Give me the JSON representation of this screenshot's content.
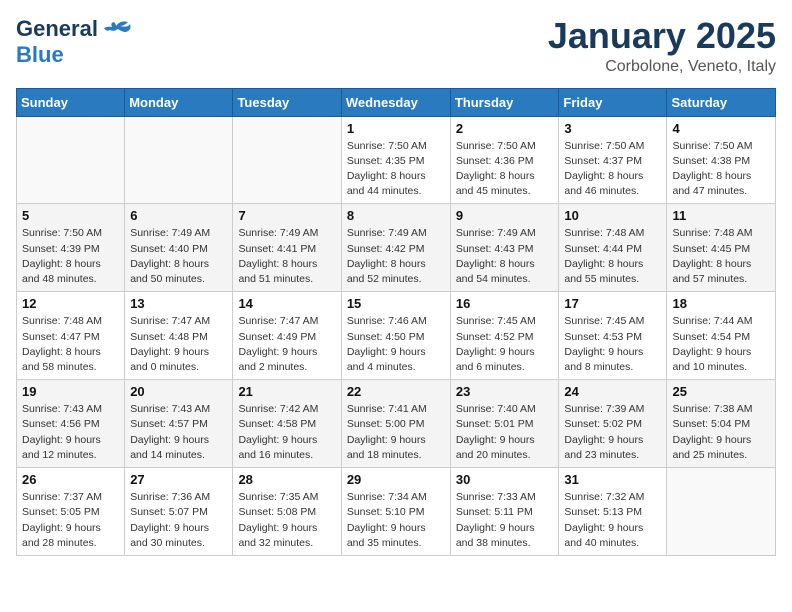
{
  "header": {
    "logo_line1": "General",
    "logo_line2": "Blue",
    "month": "January 2025",
    "location": "Corbolone, Veneto, Italy"
  },
  "days_of_week": [
    "Sunday",
    "Monday",
    "Tuesday",
    "Wednesday",
    "Thursday",
    "Friday",
    "Saturday"
  ],
  "weeks": [
    [
      {
        "day": "",
        "info": ""
      },
      {
        "day": "",
        "info": ""
      },
      {
        "day": "",
        "info": ""
      },
      {
        "day": "1",
        "info": "Sunrise: 7:50 AM\nSunset: 4:35 PM\nDaylight: 8 hours\nand 44 minutes."
      },
      {
        "day": "2",
        "info": "Sunrise: 7:50 AM\nSunset: 4:36 PM\nDaylight: 8 hours\nand 45 minutes."
      },
      {
        "day": "3",
        "info": "Sunrise: 7:50 AM\nSunset: 4:37 PM\nDaylight: 8 hours\nand 46 minutes."
      },
      {
        "day": "4",
        "info": "Sunrise: 7:50 AM\nSunset: 4:38 PM\nDaylight: 8 hours\nand 47 minutes."
      }
    ],
    [
      {
        "day": "5",
        "info": "Sunrise: 7:50 AM\nSunset: 4:39 PM\nDaylight: 8 hours\nand 48 minutes."
      },
      {
        "day": "6",
        "info": "Sunrise: 7:49 AM\nSunset: 4:40 PM\nDaylight: 8 hours\nand 50 minutes."
      },
      {
        "day": "7",
        "info": "Sunrise: 7:49 AM\nSunset: 4:41 PM\nDaylight: 8 hours\nand 51 minutes."
      },
      {
        "day": "8",
        "info": "Sunrise: 7:49 AM\nSunset: 4:42 PM\nDaylight: 8 hours\nand 52 minutes."
      },
      {
        "day": "9",
        "info": "Sunrise: 7:49 AM\nSunset: 4:43 PM\nDaylight: 8 hours\nand 54 minutes."
      },
      {
        "day": "10",
        "info": "Sunrise: 7:48 AM\nSunset: 4:44 PM\nDaylight: 8 hours\nand 55 minutes."
      },
      {
        "day": "11",
        "info": "Sunrise: 7:48 AM\nSunset: 4:45 PM\nDaylight: 8 hours\nand 57 minutes."
      }
    ],
    [
      {
        "day": "12",
        "info": "Sunrise: 7:48 AM\nSunset: 4:47 PM\nDaylight: 8 hours\nand 58 minutes."
      },
      {
        "day": "13",
        "info": "Sunrise: 7:47 AM\nSunset: 4:48 PM\nDaylight: 9 hours\nand 0 minutes."
      },
      {
        "day": "14",
        "info": "Sunrise: 7:47 AM\nSunset: 4:49 PM\nDaylight: 9 hours\nand 2 minutes."
      },
      {
        "day": "15",
        "info": "Sunrise: 7:46 AM\nSunset: 4:50 PM\nDaylight: 9 hours\nand 4 minutes."
      },
      {
        "day": "16",
        "info": "Sunrise: 7:45 AM\nSunset: 4:52 PM\nDaylight: 9 hours\nand 6 minutes."
      },
      {
        "day": "17",
        "info": "Sunrise: 7:45 AM\nSunset: 4:53 PM\nDaylight: 9 hours\nand 8 minutes."
      },
      {
        "day": "18",
        "info": "Sunrise: 7:44 AM\nSunset: 4:54 PM\nDaylight: 9 hours\nand 10 minutes."
      }
    ],
    [
      {
        "day": "19",
        "info": "Sunrise: 7:43 AM\nSunset: 4:56 PM\nDaylight: 9 hours\nand 12 minutes."
      },
      {
        "day": "20",
        "info": "Sunrise: 7:43 AM\nSunset: 4:57 PM\nDaylight: 9 hours\nand 14 minutes."
      },
      {
        "day": "21",
        "info": "Sunrise: 7:42 AM\nSunset: 4:58 PM\nDaylight: 9 hours\nand 16 minutes."
      },
      {
        "day": "22",
        "info": "Sunrise: 7:41 AM\nSunset: 5:00 PM\nDaylight: 9 hours\nand 18 minutes."
      },
      {
        "day": "23",
        "info": "Sunrise: 7:40 AM\nSunset: 5:01 PM\nDaylight: 9 hours\nand 20 minutes."
      },
      {
        "day": "24",
        "info": "Sunrise: 7:39 AM\nSunset: 5:02 PM\nDaylight: 9 hours\nand 23 minutes."
      },
      {
        "day": "25",
        "info": "Sunrise: 7:38 AM\nSunset: 5:04 PM\nDaylight: 9 hours\nand 25 minutes."
      }
    ],
    [
      {
        "day": "26",
        "info": "Sunrise: 7:37 AM\nSunset: 5:05 PM\nDaylight: 9 hours\nand 28 minutes."
      },
      {
        "day": "27",
        "info": "Sunrise: 7:36 AM\nSunset: 5:07 PM\nDaylight: 9 hours\nand 30 minutes."
      },
      {
        "day": "28",
        "info": "Sunrise: 7:35 AM\nSunset: 5:08 PM\nDaylight: 9 hours\nand 32 minutes."
      },
      {
        "day": "29",
        "info": "Sunrise: 7:34 AM\nSunset: 5:10 PM\nDaylight: 9 hours\nand 35 minutes."
      },
      {
        "day": "30",
        "info": "Sunrise: 7:33 AM\nSunset: 5:11 PM\nDaylight: 9 hours\nand 38 minutes."
      },
      {
        "day": "31",
        "info": "Sunrise: 7:32 AM\nSunset: 5:13 PM\nDaylight: 9 hours\nand 40 minutes."
      },
      {
        "day": "",
        "info": ""
      }
    ]
  ]
}
